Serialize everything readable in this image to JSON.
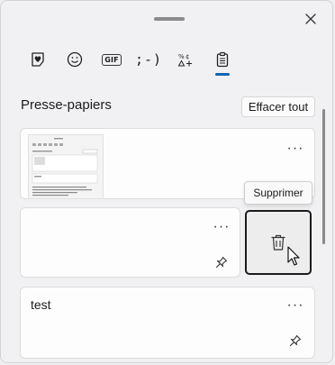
{
  "panel": {
    "tabs": [
      {
        "icon": "heart-sticker-icon",
        "label": ""
      },
      {
        "icon": "emoji-smiley-icon",
        "label": ""
      },
      {
        "icon": "gif-icon",
        "label": "GIF"
      },
      {
        "icon": "kaomoji-icon",
        "label": ";-)"
      },
      {
        "icon": "symbols-icon",
        "label": ""
      },
      {
        "icon": "clipboard-icon",
        "label": "",
        "selected": true
      }
    ],
    "accent_color": "#0a63b5"
  },
  "clipboard": {
    "title": "Presse-papiers",
    "clear_label": "Effacer tout",
    "items": [
      {
        "type": "image",
        "more": "···"
      },
      {
        "type": "empty",
        "more": "···"
      },
      {
        "type": "text",
        "text": "test",
        "more": "···"
      }
    ],
    "delete_tooltip": "Supprimer"
  }
}
